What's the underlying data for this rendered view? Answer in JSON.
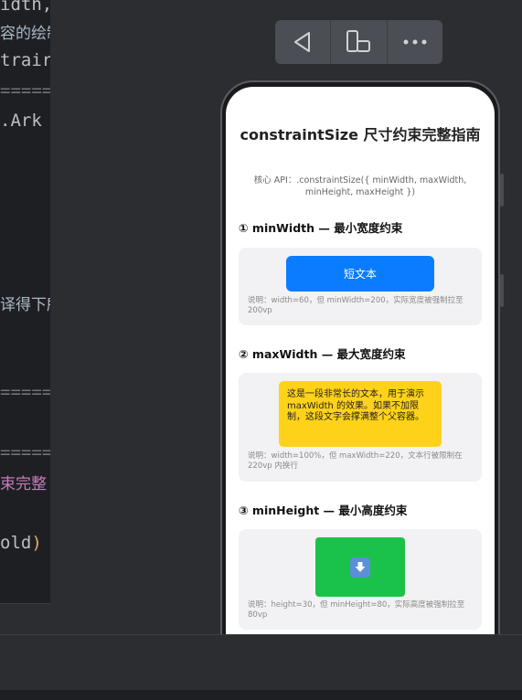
{
  "editor": {
    "lines": [
      "idth,",
      "容的绘制",
      "trair",
      "=====",
      ".Ark",
      "译得下所",
      "=====",
      "=====",
      "束完整",
      "old"
    ],
    "closing_paren": ")"
  },
  "preview_toolbar": {
    "back_icon": "back-triangle-icon",
    "device_icon": "device-rotate-icon",
    "more_icon": "more-dots-icon"
  },
  "app": {
    "title": "constraintSize 尺寸约束完整指南",
    "subtitle": "核心 API：.constraintSize({ minWidth, maxWidth, minHeight, maxHeight })",
    "sections": [
      {
        "heading": "① minWidth — 最小宽度约束",
        "demo_label": "短文本",
        "note": "说明：width=60，但 minWidth=200，实际宽度被强制拉至 200vp"
      },
      {
        "heading": "② maxWidth — 最大宽度约束",
        "demo_label": "这是一段非常长的文本，用于演示 maxWidth 的效果。如果不加限制，这段文字会撑满整个父容器。",
        "note": "说明：width=100%，但 maxWidth=220，文本行被限制在 220vp 内换行"
      },
      {
        "heading": "③ minHeight — 最小高度约束",
        "demo_icon": "download-arrow-icon",
        "note": "说明：height=30，但 minHeight=80，实际高度被强制拉至 80vp"
      }
    ]
  },
  "colors": {
    "blue": "#0a7cff",
    "yellow": "#ffd21a",
    "green": "#1bc24a",
    "card_bg": "#f2f2f4"
  }
}
